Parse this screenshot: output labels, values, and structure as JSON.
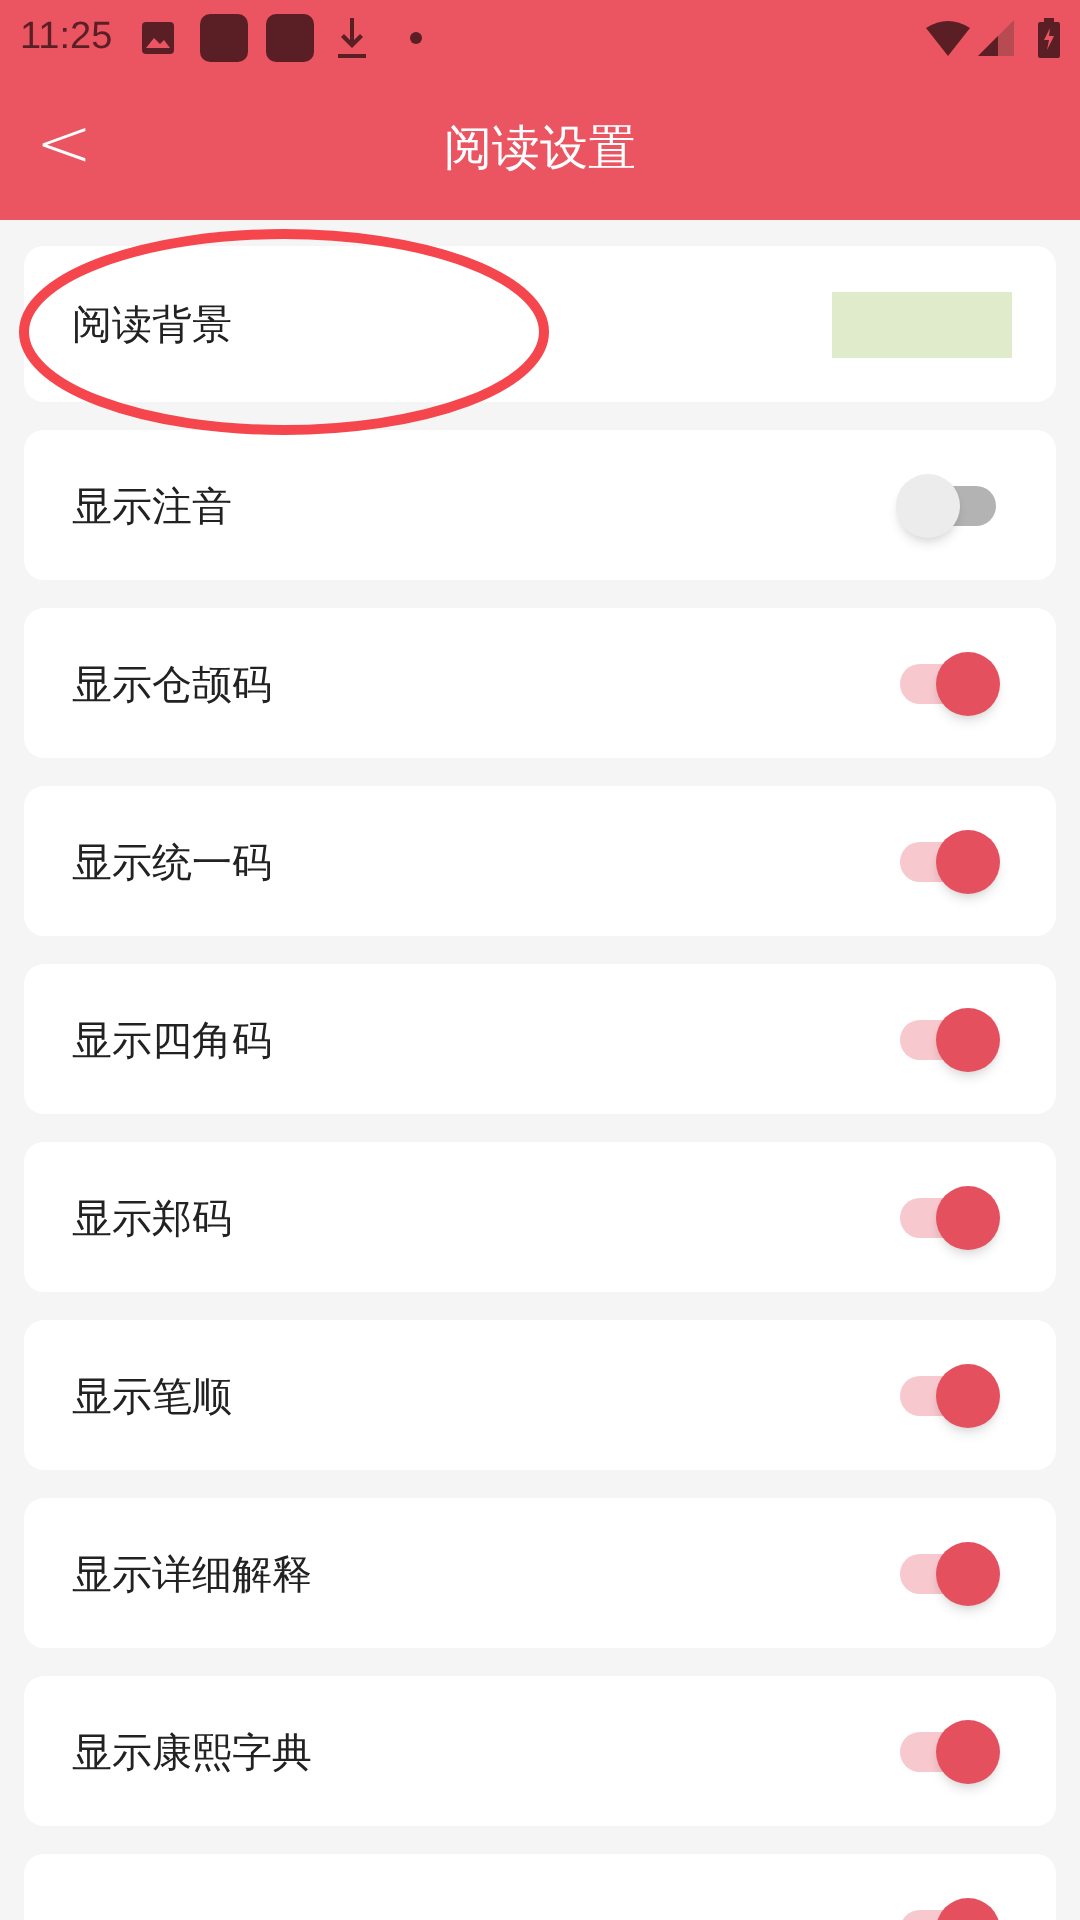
{
  "status_bar": {
    "time": "11:25"
  },
  "header": {
    "title": "阅读设置",
    "back": "<"
  },
  "settings": [
    {
      "kind": "color",
      "label": "阅读背景",
      "color": "#e0ebcc"
    },
    {
      "kind": "toggle",
      "label": "显示注音",
      "on": false
    },
    {
      "kind": "toggle",
      "label": "显示仓颉码",
      "on": true
    },
    {
      "kind": "toggle",
      "label": "显示统一码",
      "on": true
    },
    {
      "kind": "toggle",
      "label": "显示四角码",
      "on": true
    },
    {
      "kind": "toggle",
      "label": "显示郑码",
      "on": true
    },
    {
      "kind": "toggle",
      "label": "显示笔顺",
      "on": true
    },
    {
      "kind": "toggle",
      "label": "显示详细解释",
      "on": true
    },
    {
      "kind": "toggle",
      "label": "显示康熙字典",
      "on": true
    },
    {
      "kind": "toggle",
      "on": true
    }
  ]
}
